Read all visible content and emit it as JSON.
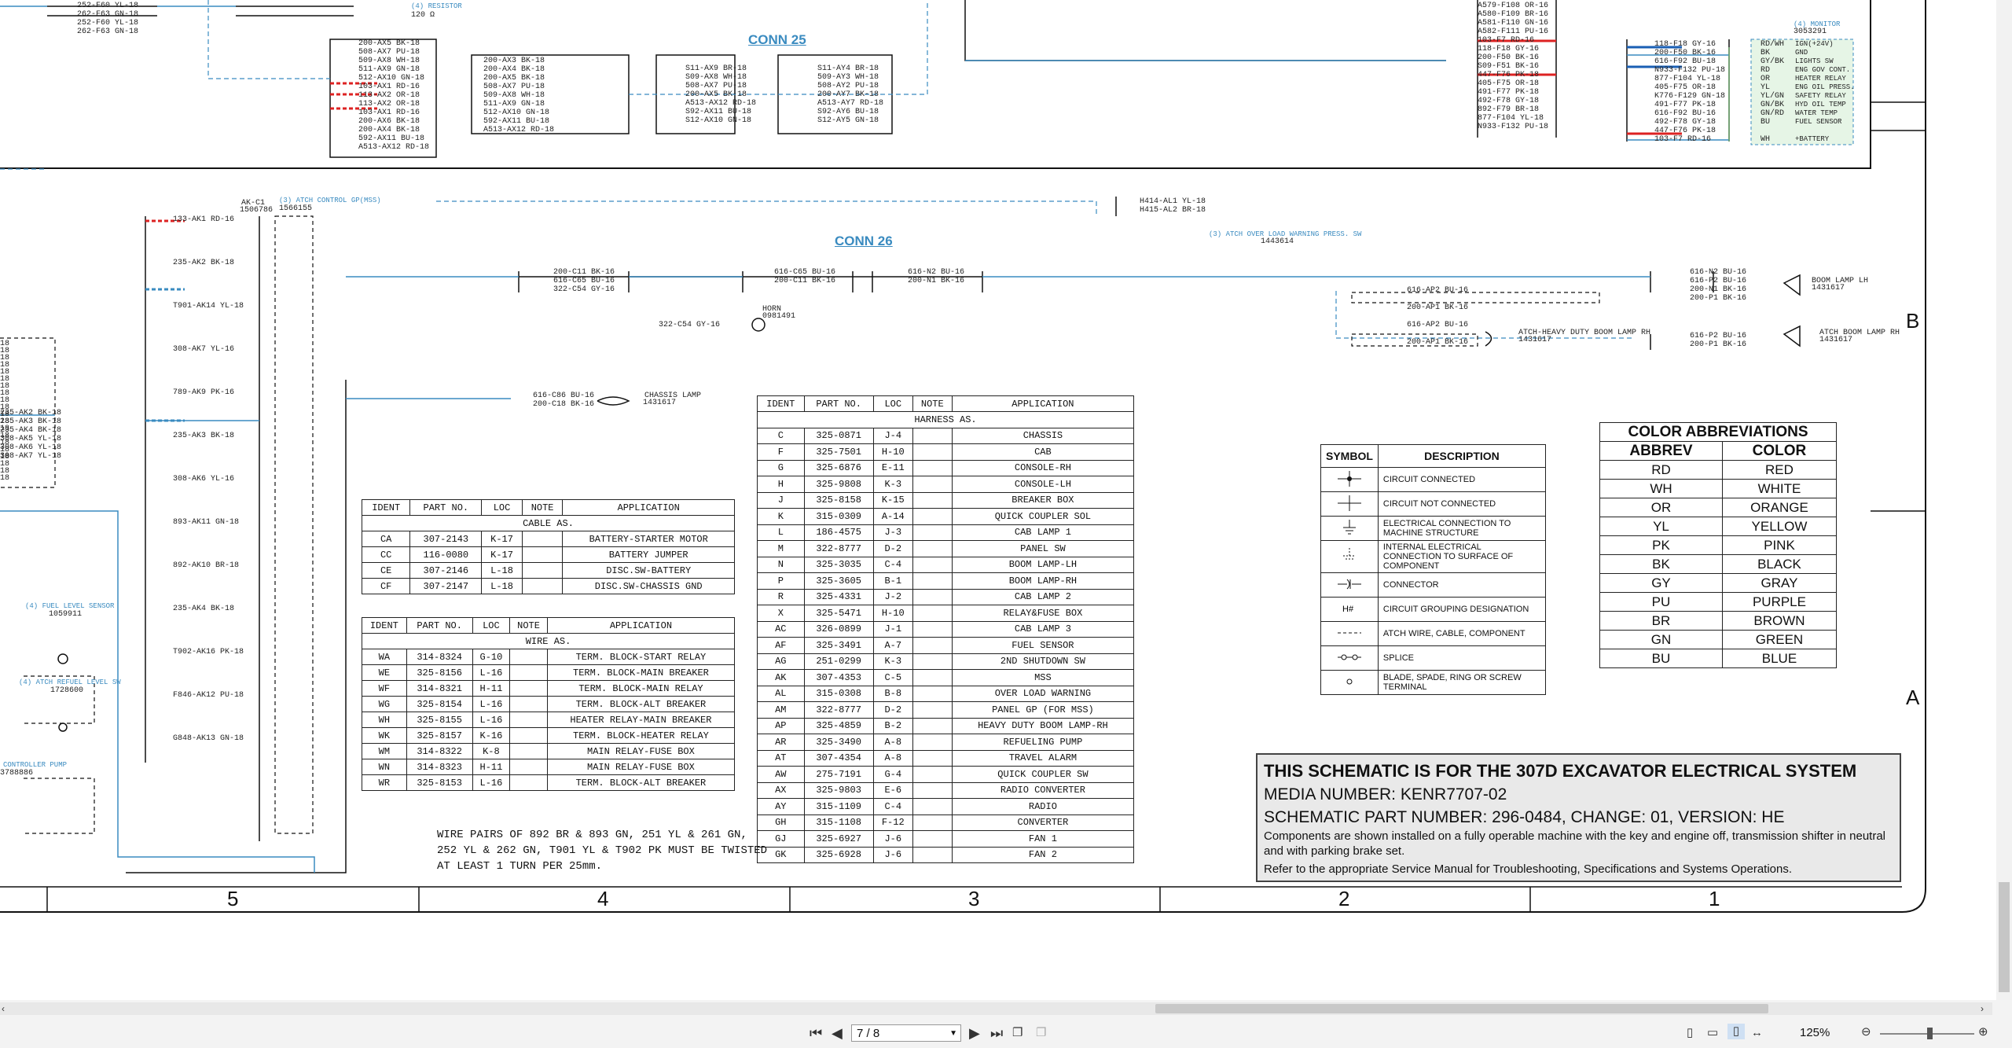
{
  "conn_titles": {
    "conn25": "CONN 25",
    "conn26": "CONN 26"
  },
  "refs": {
    "resistor": "(4) RESISTOR",
    "resistor_val": "120 Ω",
    "monitor": "(4) MONITOR",
    "monitor_pn": "3053291",
    "atch_control": "(3) ATCH CONTROL GP(MSS)",
    "atch_control_pn": "1566155",
    "akc1": "AK-C1",
    "akc1_pn": "1506786",
    "atch_overload": "(3) ATCH OVER LOAD WARNING PRESS. SW",
    "atch_overload_pn": "1443614",
    "fuel_level": "(4) FUEL LEVEL SENSOR",
    "fuel_level_pn": "1059911",
    "atch_refuel": "(4) ATCH REFUEL LEVEL SW",
    "atch_refuel_pn": "1728600",
    "controller_pump": "CONTROLLER PUMP",
    "controller_pump_pn": "3788886",
    "chassis_lamp": "CHASSIS LAMP",
    "chassis_lamp_pn": "1431617",
    "boom_lamp_lh": "BOOM LAMP LH",
    "boom_lamp_lh_pn": "1431617",
    "boom_lamp_rh": "ATCH BOOM LAMP RH",
    "boom_lamp_rh_pn": "1431617",
    "heavy_boom": "ATCH-HEAVY DUTY BOOM LAMP RH",
    "heavy_boom_pn": "1431617",
    "horn": "HORN",
    "horn_pn": "0981491",
    "monitor_pins": [
      "IGN(+24V)",
      "GND",
      "LIGHTS SW",
      "ENG GOV CONT.",
      "HEATER RELAY",
      "ENG OIL PRESS.",
      "SAFETY RELAY",
      "HYD OIL TEMP",
      "WATER TEMP",
      "FUEL SENSOR",
      "",
      "+BATTERY"
    ]
  },
  "wire_labels": {
    "top_left": [
      "252-F60 YL-18",
      "262-F63 GN-18",
      "252-F60 YL-18",
      "262-F63 GN-18"
    ],
    "block_a": [
      "200-AX5 BK-18",
      "508-AX7 PU-18",
      "509-AX8 WH-18",
      "511-AX9 GN-18",
      "512-AX10 GN-18",
      "103-AX1 RD-16",
      "113-AX2 OR-18",
      "113-AX2 OR-18",
      "103-AX1 RD-16",
      "200-AX6 BK-18",
      "200-AX4 BK-18",
      "592-AX11 BU-18",
      "A513-AX12 RD-18"
    ],
    "block_b": [
      "200-AX3 BK-18",
      "200-AX4 BK-18",
      "200-AX5 BK-18",
      "508-AX7 PU-18",
      "509-AX8 WH-18",
      "511-AX9 GN-18",
      "512-AX10 GN-18",
      "592-AX11 BU-18",
      "A513-AX12 RD-18"
    ],
    "conn25_left": [
      "S11-AX9 BR-18",
      "S09-AX8 WH-18",
      "508-AX7 PU-18",
      "200-AX5 BK-18",
      "A513-AX12 RD-18",
      "S92-AX11 BU-18",
      "S12-AX10 GN-18"
    ],
    "conn25_right": [
      "S11-AY4 BR-18",
      "509-AY3 WH-18",
      "508-AY2 PU-18",
      "200-AY7 BK-18",
      "A513-AY7 RD-18",
      "S92-AY6 BU-18",
      "S12-AY5 GN-18"
    ],
    "right_top": [
      "A579-F108 OR-16",
      "A580-F109 BR-16",
      "A581-F110 GN-16",
      "A582-F111 PU-16",
      "103-F7 RD-16",
      "118-F18 GY-16",
      "200-F50 BK-16",
      "S09-F51 BK-16",
      "447-F76 PK-18",
      "405-F75 OR-18",
      "491-F77 PK-18",
      "492-F78 GY-18",
      "892-F79 BR-18",
      "877-F104 YL-18",
      "N933-F132 PU-18"
    ],
    "monitor_in": [
      "118-F18 GY-16",
      "200-F50 BK-16",
      "616-F92 BU-18",
      "N933-F132 PU-18",
      "877-F104 YL-18",
      "405-F75 OR-18",
      "K776-F129 GN-18",
      "491-F77 PK-18",
      "616-F92 BU-16",
      "492-F78 GY-18",
      "447-F76 PK-18",
      "103-F7 RD-16"
    ],
    "monitor_out": [
      "RD/WH",
      "BK",
      "GY/BK",
      "RD",
      "OR",
      "YL",
      "YL/GN",
      "GN/BK",
      "GN/RD",
      "BU",
      "",
      "WH"
    ],
    "akc1_left": [
      "133-AK1 RD-16",
      "235-AK2 BK-18",
      "T901-AK14 YL-18",
      "308-AK7 YL-16",
      "789-AK9 PK-16",
      "235-AK3 BK-18",
      "308-AK6 YL-16",
      "893-AK11 GN-18",
      "892-AK10 BR-18",
      "235-AK4 BK-18",
      "T902-AK16 PK-18",
      "F846-AK12 PU-18",
      "G848-AK13 GN-18"
    ],
    "left_edge": [
      "18",
      "18",
      "18",
      "18",
      "18",
      "18",
      "18",
      "18",
      "18",
      "18",
      "18",
      "18",
      "18",
      "18",
      "18",
      "18",
      "18",
      "18",
      "18",
      "18"
    ],
    "left_wires": [
      "235-AK2 BK-18",
      "235-AK3 BK-18",
      "235-AK4 BK-18",
      "308-AK5 YL-18",
      "308-AK6 YL-18",
      "308-AK7 YL-18"
    ],
    "chassis": [
      "616-C86 BU-16",
      "200-C18 BK-16"
    ],
    "conn26_left": [
      "200-C11 BK-16",
      "616-C65 BU-16",
      "322-C54 GY-16"
    ],
    "conn26_mid": [
      "616-C65 BU-16",
      "200-C11 BK-16"
    ],
    "conn26_right": [
      "616-N2 BU-16",
      "200-N1 BK-16"
    ],
    "horn_wire": "322-C54 GY-16",
    "overload": [
      "H414-AL1 YL-18",
      "H415-AL2 BR-18"
    ],
    "boom_lh": [
      "616-N2 BU-16",
      "616-P2 BU-16",
      "200-N1 BK-16",
      "200-P1 BK-16"
    ],
    "boom_mid": [
      "616-AP2 BU-16",
      "200-AP1 BK-16",
      "616-AP2 BU-16",
      "200-AP1 BK-16"
    ],
    "boom_rh": [
      "616-P2 BU-16",
      "200-P1 BK-16"
    ],
    "line_markers": [
      "L45",
      "L46",
      "L47",
      "L28",
      "L8",
      "L7",
      "L4",
      "L7",
      "L4"
    ]
  },
  "cable_table": {
    "headers": [
      "IDENT",
      "PART NO.",
      "LOC",
      "NOTE",
      "APPLICATION"
    ],
    "section": "CABLE AS.",
    "rows": [
      [
        "CA",
        "307-2143",
        "K-17",
        "",
        "BATTERY-STARTER MOTOR"
      ],
      [
        "CC",
        "116-0080",
        "K-17",
        "",
        "BATTERY JUMPER"
      ],
      [
        "CE",
        "307-2146",
        "L-18",
        "",
        "DISC.SW-BATTERY"
      ],
      [
        "CF",
        "307-2147",
        "L-18",
        "",
        "DISC.SW-CHASSIS GND"
      ]
    ]
  },
  "wire_table": {
    "headers": [
      "IDENT",
      "PART NO.",
      "LOC",
      "NOTE",
      "APPLICATION"
    ],
    "section": "WIRE AS.",
    "rows": [
      [
        "WA",
        "314-8324",
        "G-10",
        "",
        "TERM. BLOCK-START RELAY"
      ],
      [
        "WE",
        "325-8156",
        "L-16",
        "",
        "TERM. BLOCK-MAIN BREAKER"
      ],
      [
        "WF",
        "314-8321",
        "H-11",
        "",
        "TERM. BLOCK-MAIN RELAY"
      ],
      [
        "WG",
        "325-8154",
        "L-16",
        "",
        "TERM. BLOCK-ALT BREAKER"
      ],
      [
        "WH",
        "325-8155",
        "L-16",
        "",
        "HEATER RELAY-MAIN BREAKER"
      ],
      [
        "WK",
        "325-8157",
        "K-16",
        "",
        "TERM. BLOCK-HEATER RELAY"
      ],
      [
        "WM",
        "314-8322",
        "K-8",
        "",
        "MAIN RELAY-FUSE BOX"
      ],
      [
        "WN",
        "314-8323",
        "H-11",
        "",
        "MAIN RELAY-FUSE BOX"
      ],
      [
        "WR",
        "325-8153",
        "L-16",
        "",
        "TERM. BLOCK-ALT BREAKER"
      ]
    ]
  },
  "wire_note": [
    "WIRE PAIRS OF 892 BR & 893 GN, 251 YL & 261 GN,",
    "252 YL & 262 GN, T901 YL & T902 PK MUST BE TWISTED",
    "AT LEAST 1 TURN PER 25mm."
  ],
  "harness_table": {
    "headers": [
      "IDENT",
      "PART NO.",
      "LOC",
      "NOTE",
      "APPLICATION"
    ],
    "section": "HARNESS AS.",
    "rows": [
      [
        "C",
        "325-0871",
        "J-4",
        "",
        "CHASSIS"
      ],
      [
        "F",
        "325-7501",
        "H-10",
        "",
        "CAB"
      ],
      [
        "G",
        "325-6876",
        "E-11",
        "",
        "CONSOLE-RH"
      ],
      [
        "H",
        "325-9808",
        "K-3",
        "",
        "CONSOLE-LH"
      ],
      [
        "J",
        "325-8158",
        "K-15",
        "",
        "BREAKER BOX"
      ],
      [
        "K",
        "315-0309",
        "A-14",
        "",
        "QUICK COUPLER SOL"
      ],
      [
        "L",
        "186-4575",
        "J-3",
        "",
        "CAB LAMP 1"
      ],
      [
        "M",
        "322-8777",
        "D-2",
        "",
        "PANEL SW"
      ],
      [
        "N",
        "325-3035",
        "C-4",
        "",
        "BOOM LAMP-LH"
      ],
      [
        "P",
        "325-3605",
        "B-1",
        "",
        "BOOM LAMP-RH"
      ],
      [
        "R",
        "325-4331",
        "J-2",
        "",
        "CAB LAMP 2"
      ],
      [
        "X",
        "325-5471",
        "H-10",
        "",
        "RELAY&FUSE BOX"
      ],
      [
        "AC",
        "326-0899",
        "J-1",
        "",
        "CAB LAMP 3"
      ],
      [
        "AF",
        "325-3491",
        "A-7",
        "",
        "FUEL SENSOR"
      ],
      [
        "AG",
        "251-0299",
        "K-3",
        "",
        "2ND SHUTDOWN SW"
      ],
      [
        "AK",
        "307-4353",
        "C-5",
        "",
        "MSS"
      ],
      [
        "AL",
        "315-0308",
        "B-8",
        "",
        "OVER LOAD WARNING"
      ],
      [
        "AM",
        "322-8777",
        "D-2",
        "",
        "PANEL GP (FOR MSS)"
      ],
      [
        "AP",
        "325-4859",
        "B-2",
        "",
        "HEAVY DUTY BOOM LAMP-RH"
      ],
      [
        "AR",
        "325-3490",
        "A-8",
        "",
        "REFUELING PUMP"
      ],
      [
        "AT",
        "307-4354",
        "A-8",
        "",
        "TRAVEL ALARM"
      ],
      [
        "AW",
        "275-7191",
        "G-4",
        "",
        "QUICK COUPLER SW"
      ],
      [
        "AX",
        "325-9803",
        "E-6",
        "",
        "RADIO CONVERTER"
      ],
      [
        "AY",
        "315-1109",
        "C-4",
        "",
        "RADIO"
      ],
      [
        "GH",
        "315-1108",
        "F-12",
        "",
        "CONVERTER"
      ],
      [
        "GJ",
        "325-6927",
        "J-6",
        "",
        "FAN 1"
      ],
      [
        "GK",
        "325-6928",
        "J-6",
        "",
        "FAN 2"
      ]
    ]
  },
  "symbol_table": {
    "headers": [
      "SYMBOL",
      "DESCRIPTION"
    ],
    "rows": [
      {
        "icon": "circuit-connected-icon",
        "desc": "CIRCUIT CONNECTED"
      },
      {
        "icon": "circuit-not-connected-icon",
        "desc": "CIRCUIT NOT CONNECTED"
      },
      {
        "icon": "machine-ground-icon",
        "desc": "ELECTRICAL CONNECTION TO MACHINE STRUCTURE"
      },
      {
        "icon": "component-ground-icon",
        "desc": "INTERNAL ELECTRICAL CONNECTION TO SURFACE OF COMPONENT"
      },
      {
        "icon": "connector-icon",
        "desc": "CONNECTOR"
      },
      {
        "icon": "grouping-icon",
        "desc": "CIRCUIT GROUPING DESIGNATION"
      },
      {
        "icon": "dashed-line-icon",
        "desc": "ATCH WIRE, CABLE, COMPONENT"
      },
      {
        "icon": "splice-icon",
        "desc": "SPLICE"
      },
      {
        "icon": "terminal-icon",
        "desc": "BLADE, SPADE, RING OR SCREW TERMINAL"
      }
    ]
  },
  "color_table": {
    "title": "COLOR ABBREVIATIONS",
    "headers": [
      "ABBREV",
      "COLOR"
    ],
    "rows": [
      [
        "RD",
        "RED"
      ],
      [
        "WH",
        "WHITE"
      ],
      [
        "OR",
        "ORANGE"
      ],
      [
        "YL",
        "YELLOW"
      ],
      [
        "PK",
        "PINK"
      ],
      [
        "BK",
        "BLACK"
      ],
      [
        "GY",
        "GRAY"
      ],
      [
        "PU",
        "PURPLE"
      ],
      [
        "BR",
        "BROWN"
      ],
      [
        "GN",
        "GREEN"
      ],
      [
        "BU",
        "BLUE"
      ]
    ]
  },
  "info": {
    "title": "THIS SCHEMATIC IS FOR THE 307D EXCAVATOR ELECTRICAL SYSTEM",
    "media": "MEDIA NUMBER: KENR7707-02",
    "part": "SCHEMATIC PART NUMBER: 296-0484, CHANGE: 01, VERSION: HE",
    "note1": "Components are shown installed on a fully operable machine with the key and engine off, transmission shifter in neutral and with parking brake set.",
    "note2": "Refer to the appropriate Service Manual for Troubleshooting, Specifications and Systems Operations."
  },
  "zones": {
    "cols": [
      "5",
      "4",
      "3",
      "2",
      "1"
    ],
    "rows": [
      "B",
      "A"
    ]
  },
  "viewer": {
    "page": "7 / 8",
    "zoom": "125%",
    "accent": "#3a8bc0"
  }
}
